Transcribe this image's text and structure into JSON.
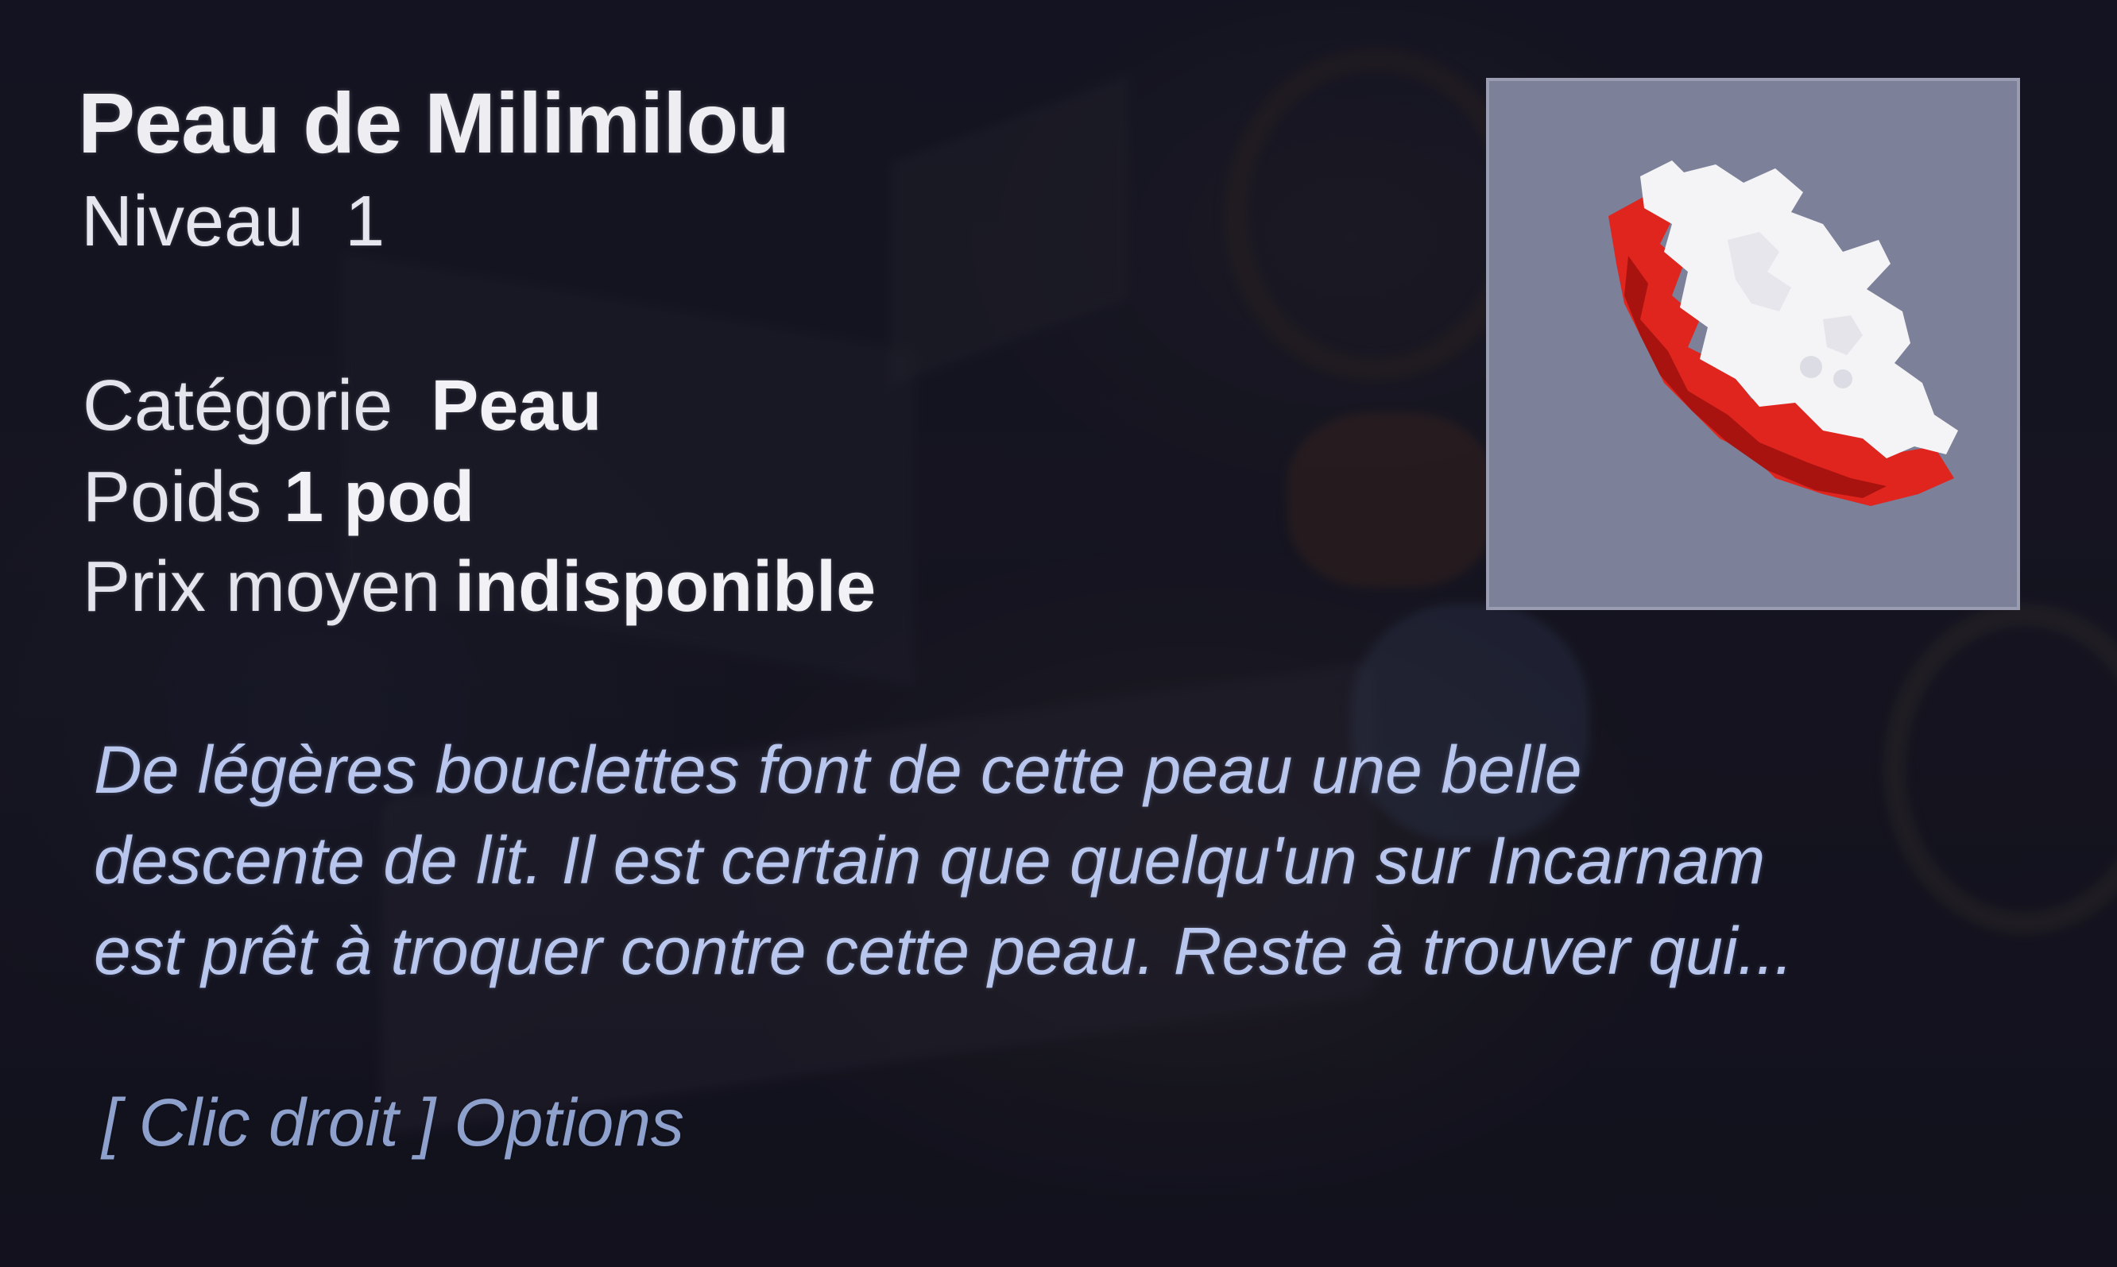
{
  "item": {
    "name": "Peau de Milimilou",
    "level_label": "Niveau",
    "level_value": "1",
    "category_label": "Catégorie",
    "category_value": "Peau",
    "weight_label": "Poids",
    "weight_value": "1 pod",
    "price_label": "Prix moyen",
    "price_value": "indisponible",
    "description_lines": [
      "De légères bouclettes font de cette peau une belle",
      "descente de lit. Il est certain que quelqu'un sur Incarnam",
      "est prêt à troquer contre cette peau. Reste à trouver qui..."
    ],
    "icon": "sheep-skin-icon"
  },
  "hint": "[ Clic droit ] Options",
  "colors": {
    "title": "#eeeef2",
    "description": "#b8c6ee",
    "hint": "#8ea0cc",
    "icon_frame": "#7c8099",
    "skin_white": "#f4f4f6",
    "skin_red": "#e0241e"
  }
}
